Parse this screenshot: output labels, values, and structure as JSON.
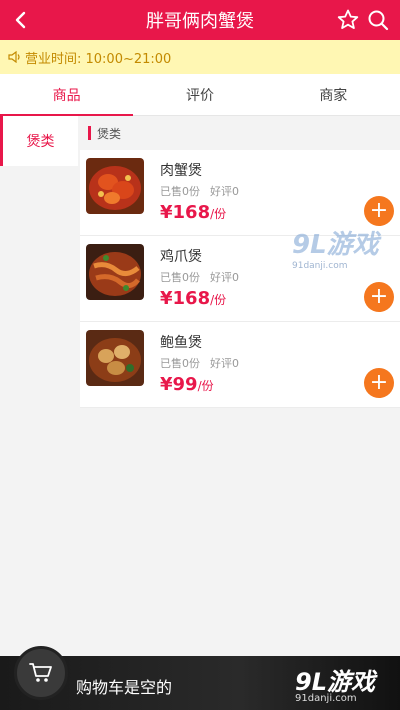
{
  "header": {
    "title": "胖哥俩肉蟹煲",
    "back_icon": "chevron-left-icon",
    "star_icon": "star-icon",
    "search_icon": "search-icon"
  },
  "notice": {
    "text": "营业时间: 10:00~21:00",
    "icon": "speaker-icon"
  },
  "tabs": [
    {
      "label": "商品",
      "active": true
    },
    {
      "label": "评价",
      "active": false
    },
    {
      "label": "商家",
      "active": false
    }
  ],
  "sidebar": {
    "items": [
      {
        "label": "煲类",
        "active": true
      }
    ]
  },
  "category": {
    "title": "煲类"
  },
  "products": [
    {
      "name": "肉蟹煲",
      "sold": "已售0份",
      "rating": "好评0",
      "price": "¥168",
      "unit": "/份"
    },
    {
      "name": "鸡爪煲",
      "sold": "已售0份",
      "rating": "好评0",
      "price": "¥168",
      "unit": "/份"
    },
    {
      "name": "鲍鱼煲",
      "sold": "已售0份",
      "rating": "好评0",
      "price": "¥99",
      "unit": "/份"
    }
  ],
  "cart": {
    "text": "购物车是空的",
    "icon": "cart-icon"
  },
  "watermark": {
    "brand": "9L游戏",
    "site": "91danji.com"
  },
  "colors": {
    "brand": "#e8174a",
    "add": "#f5771e",
    "notice_bg": "#fff7b3"
  }
}
